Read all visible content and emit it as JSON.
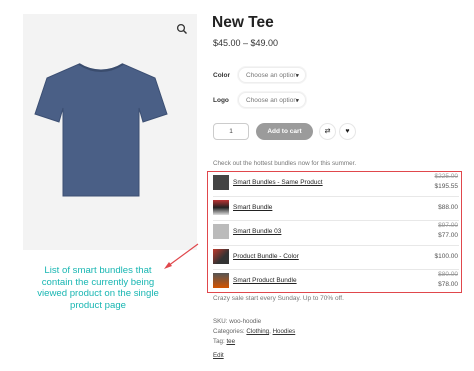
{
  "product": {
    "title": "New Tee",
    "price": "$45.00 – $49.00",
    "color_label": "Color",
    "color_placeholder": "Choose an option",
    "logo_label": "Logo",
    "logo_placeholder": "Choose an option",
    "quantity": "1",
    "add_to_cart": "Add to cart"
  },
  "icons": {
    "zoom": "magnifier-icon",
    "compare": "arrows-exchange-icon",
    "wishlist": "heart-icon",
    "select_caret": "caret-down-icon"
  },
  "bundles": {
    "intro": "Check out the hottest bundles now for this summer.",
    "items": [
      {
        "name": "Smart Bundles - Same Product",
        "old_price": "$225.00",
        "price": "$195.55"
      },
      {
        "name": "Smart Bundle",
        "old_price": "",
        "price": "$88.00"
      },
      {
        "name": "Smart Bundle 03",
        "old_price": "$97.00",
        "price": "$77.00"
      },
      {
        "name": "Product Bundle - Color",
        "old_price": "",
        "price": "$100.00"
      },
      {
        "name": "Smart Product Bundle",
        "old_price": "$80.00",
        "price": "$78.00"
      }
    ],
    "highlight_color": "#e0474c"
  },
  "sale_text": "Crazy sale start every Sunday. Up to 70% off.",
  "meta": {
    "sku_label": "SKU:",
    "sku": "woo-hoodie",
    "categories_label": "Categories:",
    "category_1": "Clothing",
    "category_sep": ",",
    "category_2": "Hoodies",
    "tag_label": "Tag:",
    "tag": "tee",
    "edit": "Edit"
  },
  "callout": {
    "text": "List of smart bundles that contain the currently being viewed product on the single product page",
    "color": "#18b6b2"
  }
}
